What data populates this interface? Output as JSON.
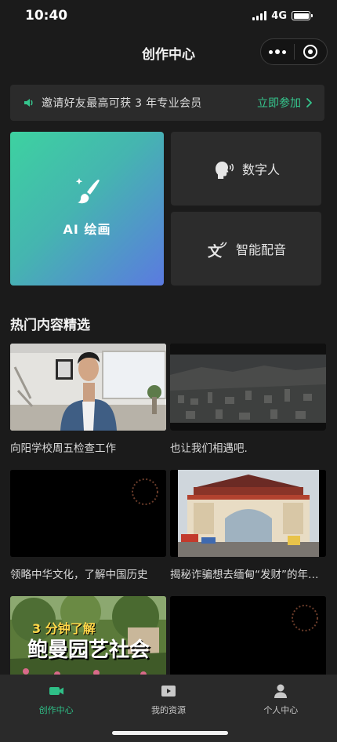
{
  "status": {
    "time": "10:40",
    "network": "4G"
  },
  "nav": {
    "title": "创作中心"
  },
  "banner": {
    "text": "邀请好友最高可获 3 年专业会员",
    "action": "立即参加"
  },
  "tools": {
    "ai_paint": "AI 绘画",
    "digital_human": "数字人",
    "smart_dubbing": "智能配音"
  },
  "section": {
    "title": "热门内容精选"
  },
  "feed": [
    {
      "caption": "向阳学校周五检查工作"
    },
    {
      "caption": "也让我们相遇吧."
    },
    {
      "caption": "领略中华文化，了解中国历史"
    },
    {
      "caption": "揭秘诈骗想去缅甸“发财”的年轻人"
    },
    {
      "overlay_small": "3 分钟了解",
      "overlay_big": "鲍曼园艺社会"
    },
    {
      "caption": ""
    }
  ],
  "tabs": [
    {
      "label": "创作中心",
      "icon": "video-camera-icon",
      "active": true
    },
    {
      "label": "我的资源",
      "icon": "play-folder-icon",
      "active": false
    },
    {
      "label": "个人中心",
      "icon": "user-icon",
      "active": false
    }
  ],
  "colors": {
    "accent": "#2fbf87",
    "background": "#1b1b1b",
    "card": "#2c2c2c"
  }
}
